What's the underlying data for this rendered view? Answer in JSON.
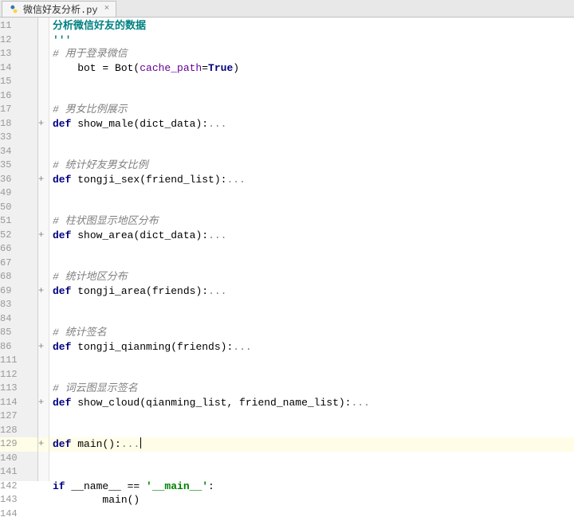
{
  "tab": {
    "filename": "微信好友分析.py",
    "close_glyph": "×"
  },
  "lines": [
    {
      "num": "11",
      "fold": "",
      "html": "        <span class='docstring'>分析微信好友的数据</span>"
    },
    {
      "num": "12",
      "fold": "",
      "html": "    <span class='docstring'>'''</span>"
    },
    {
      "num": "13",
      "fold": "",
      "html": "    <span class='comment'># 用于登录微信</span>"
    },
    {
      "num": "14",
      "fold": "",
      "html": "    bot = Bot(<span class='param'>cache_path</span>=<span class='keyword'>True</span>)"
    },
    {
      "num": "15",
      "fold": "",
      "html": ""
    },
    {
      "num": "16",
      "fold": "",
      "html": ""
    },
    {
      "num": "17",
      "fold": "",
      "html": "    <span class='comment'># 男女比例展示</span>"
    },
    {
      "num": "18",
      "fold": "+",
      "html": "    <span class='keyword'>def </span><span class='funcname'>show_male</span>(dict_data):<span class='fold-dots'>...</span>"
    },
    {
      "num": "33",
      "fold": "",
      "html": ""
    },
    {
      "num": "34",
      "fold": "",
      "html": ""
    },
    {
      "num": "35",
      "fold": "",
      "html": "    <span class='comment'># 统计好友男女比例</span>"
    },
    {
      "num": "36",
      "fold": "+",
      "html": "    <span class='keyword'>def </span><span class='funcname'>tongji_sex</span>(friend_list):<span class='fold-dots'>...</span>"
    },
    {
      "num": "49",
      "fold": "",
      "html": ""
    },
    {
      "num": "50",
      "fold": "",
      "html": ""
    },
    {
      "num": "51",
      "fold": "",
      "html": "    <span class='comment'># 柱状图显示地区分布</span>"
    },
    {
      "num": "52",
      "fold": "+",
      "html": "    <span class='keyword'>def </span><span class='funcname'>show_area</span>(dict_data):<span class='fold-dots'>...</span>"
    },
    {
      "num": "66",
      "fold": "",
      "html": ""
    },
    {
      "num": "67",
      "fold": "",
      "html": ""
    },
    {
      "num": "68",
      "fold": "",
      "html": "    <span class='comment'># 统计地区分布</span>"
    },
    {
      "num": "69",
      "fold": "+",
      "html": "    <span class='keyword'>def </span><span class='funcname'>tongji_area</span>(friends):<span class='fold-dots'>...</span>"
    },
    {
      "num": "83",
      "fold": "",
      "html": ""
    },
    {
      "num": "84",
      "fold": "",
      "html": ""
    },
    {
      "num": "85",
      "fold": "",
      "html": "    <span class='comment'># 统计签名</span>"
    },
    {
      "num": "86",
      "fold": "+",
      "html": "    <span class='keyword'>def </span><span class='funcname'>tongji_qianming</span>(friends):<span class='fold-dots'>...</span>"
    },
    {
      "num": "111",
      "fold": "",
      "html": ""
    },
    {
      "num": "112",
      "fold": "",
      "html": ""
    },
    {
      "num": "113",
      "fold": "",
      "html": "    <span class='comment'># 词云图显示签名</span>"
    },
    {
      "num": "114",
      "fold": "+",
      "html": "    <span class='keyword'>def </span><span class='funcname'>show_cloud</span>(qianming_list, friend_name_list):<span class='fold-dots'>...</span>"
    },
    {
      "num": "127",
      "fold": "",
      "html": ""
    },
    {
      "num": "128",
      "fold": "",
      "html": ""
    },
    {
      "num": "129",
      "fold": "+",
      "html": "    <span class='keyword'>def </span><span class='funcname'>main</span>():<span class='fold-dots'>...</span>",
      "current": true,
      "cursor": true
    },
    {
      "num": "140",
      "fold": "",
      "html": ""
    },
    {
      "num": "141",
      "fold": "",
      "html": ""
    },
    {
      "num": "142",
      "fold": "",
      "html": "    <span class='keyword'>if </span>__name__ == <span class='string'>'__main__'</span>:"
    },
    {
      "num": "143",
      "fold": "",
      "html": "        main()"
    },
    {
      "num": "144",
      "fold": "",
      "html": ""
    }
  ]
}
